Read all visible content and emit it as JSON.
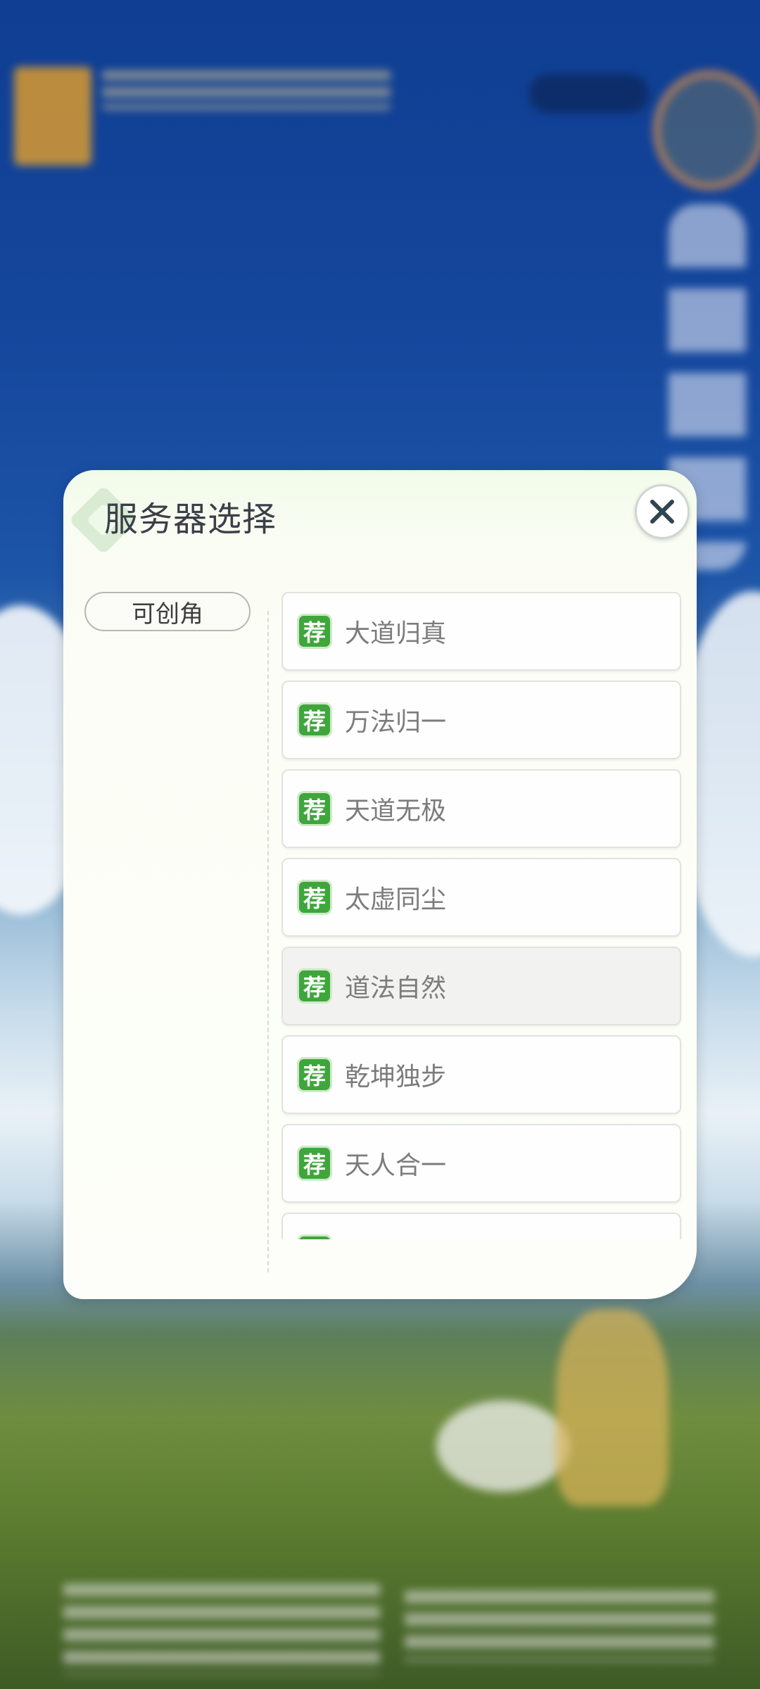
{
  "dialog": {
    "title": "服务器选择",
    "close_icon": "close-icon"
  },
  "filter_tabs": [
    {
      "label": "可创角",
      "selected": true
    }
  ],
  "servers": [
    {
      "badge": "荐",
      "name": "大道归真",
      "selected": false
    },
    {
      "badge": "荐",
      "name": "万法归一",
      "selected": false
    },
    {
      "badge": "荐",
      "name": "天道无极",
      "selected": false
    },
    {
      "badge": "荐",
      "name": "太虚同尘",
      "selected": false
    },
    {
      "badge": "荐",
      "name": "道法自然",
      "selected": true
    },
    {
      "badge": "荐",
      "name": "乾坤独步",
      "selected": false
    },
    {
      "badge": "荐",
      "name": "天人合一",
      "selected": false
    },
    {
      "badge": "荐",
      "name": "",
      "selected": false
    }
  ],
  "colors": {
    "badge_green": "#3fa63c",
    "dialog_bg": "#fdfef9",
    "title_text": "#3b3f48",
    "item_text": "#7c7c7c"
  }
}
